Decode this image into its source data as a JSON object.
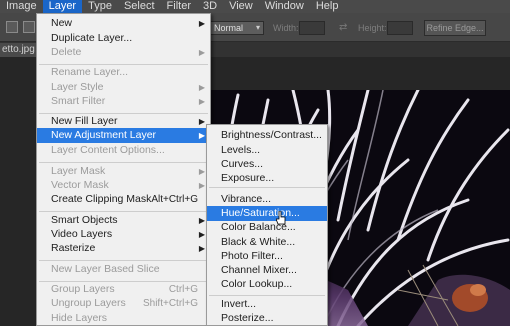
{
  "menubar": {
    "items": [
      "Image",
      "Layer",
      "Type",
      "Select",
      "Filter",
      "3D",
      "View",
      "Window",
      "Help"
    ]
  },
  "options": {
    "blend_mode": "Normal",
    "width_label": "Width:",
    "height_label": "Height:",
    "refine_edge": "Refine Edge..."
  },
  "document": {
    "tab_title": "etto.jpg @"
  },
  "layer_menu": {
    "new": "New",
    "duplicate_layer": "Duplicate Layer...",
    "delete": "Delete",
    "rename_layer": "Rename Layer...",
    "layer_style": "Layer Style",
    "smart_filter": "Smart Filter",
    "new_fill_layer": "New Fill Layer",
    "new_adjustment_layer": "New Adjustment Layer",
    "layer_content_options": "Layer Content Options...",
    "layer_mask": "Layer Mask",
    "vector_mask": "Vector Mask",
    "create_clipping_mask": "Create Clipping Mask",
    "create_clipping_mask_shortcut": "Alt+Ctrl+G",
    "smart_objects": "Smart Objects",
    "video_layers": "Video Layers",
    "rasterize": "Rasterize",
    "new_layer_based_slice": "New Layer Based Slice",
    "group_layers": "Group Layers",
    "group_layers_shortcut": "Ctrl+G",
    "ungroup_layers": "Ungroup Layers",
    "ungroup_layers_shortcut": "Shift+Ctrl+G",
    "hide_layers": "Hide Layers"
  },
  "adjustment_submenu": {
    "items": [
      "Brightness/Contrast...",
      "Levels...",
      "Curves...",
      "Exposure...",
      "Vibrance...",
      "Hue/Saturation...",
      "Color Balance...",
      "Black & White...",
      "Photo Filter...",
      "Channel Mixer...",
      "Color Lookup...",
      "Invert...",
      "Posterize..."
    ]
  },
  "colors": {
    "menu_highlight": "#2a7be2",
    "menubar_active": "#1a66c9",
    "menu_background": "#f0f0f0"
  }
}
